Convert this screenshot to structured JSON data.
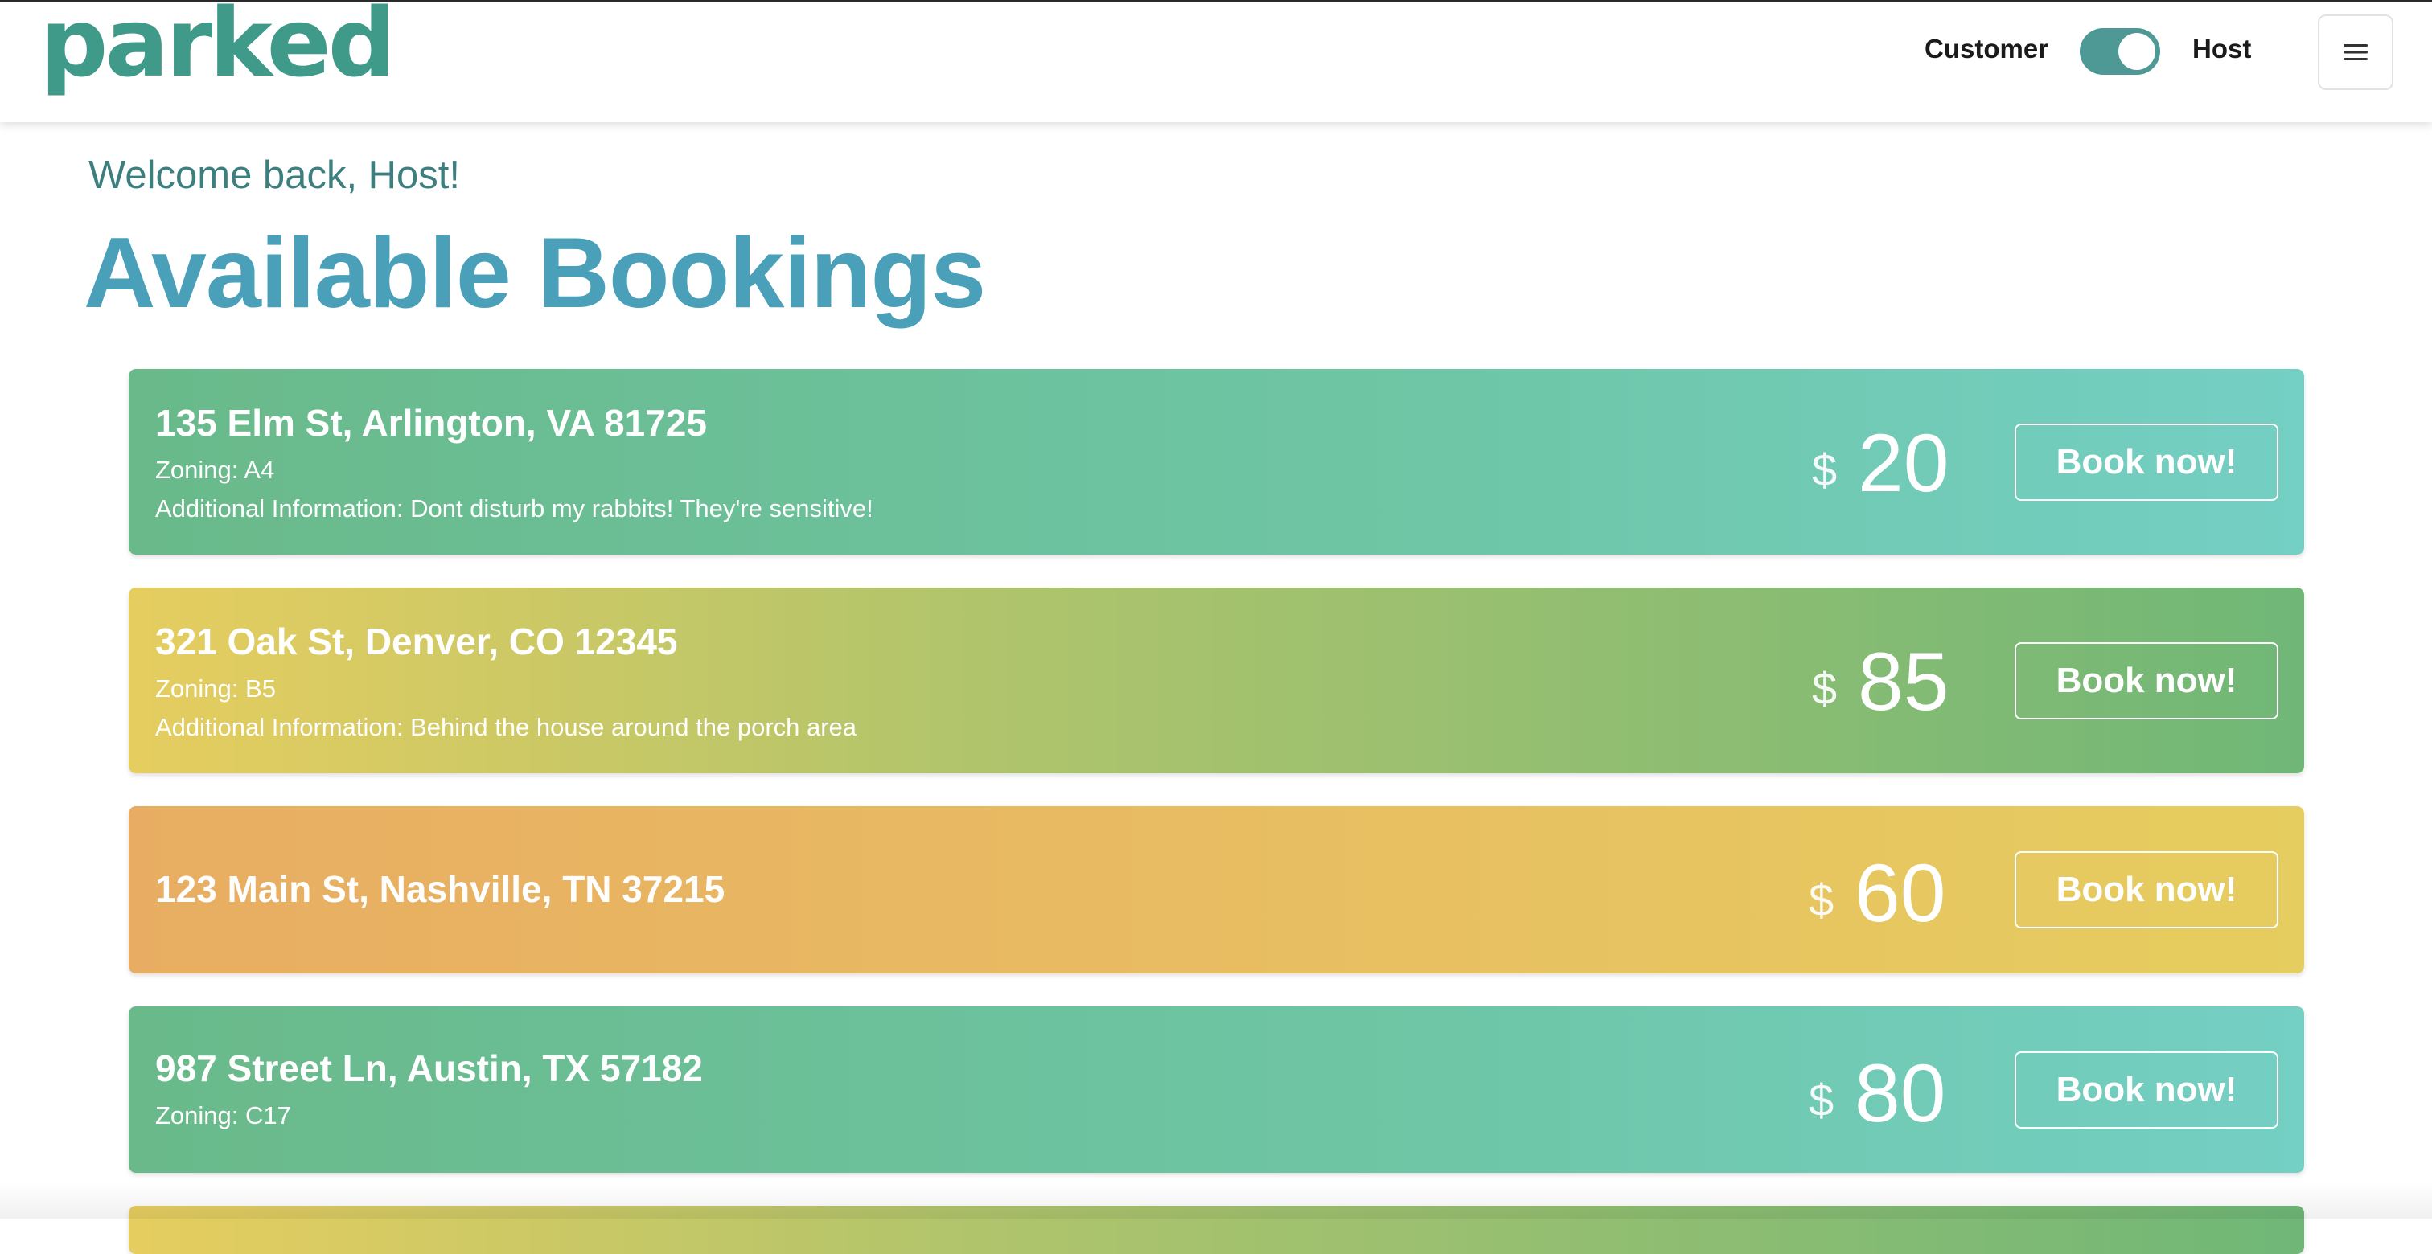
{
  "header": {
    "logo": "parked",
    "mode_customer": "Customer",
    "mode_host": "Host",
    "toggle_state": "host",
    "menu_icon": "hamburger-icon"
  },
  "welcome": "Welcome back, Host!",
  "title": "Available Bookings",
  "currency_symbol": "$",
  "book_label": "Book now!",
  "bookings": [
    {
      "address": "135 Elm St, Arlington, VA 81725",
      "zoning": "Zoning: A4",
      "info": "Additional Information: Dont disturb my rabbits! They're sensitive!",
      "price": "20"
    },
    {
      "address": "321 Oak St, Denver, CO 12345",
      "zoning": "Zoning: B5",
      "info": "Additional Information: Behind the house around the porch area",
      "price": "85"
    },
    {
      "address": "123 Main St, Nashville, TN 37215",
      "price": "60"
    },
    {
      "address": "987 Street Ln, Austin, TX 57182",
      "zoning": "Zoning: C17",
      "price": "80"
    }
  ],
  "colors": {
    "brand": "#3f9a8a",
    "title": "#4aa0b8",
    "welcome": "#3d7f7f",
    "toggle": "#4e9896"
  }
}
